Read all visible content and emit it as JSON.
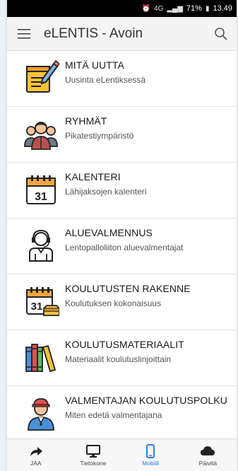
{
  "status_bar": {
    "battery": "71%",
    "time": "13.49",
    "network": "4G"
  },
  "app_bar": {
    "title": "eLENTIS - Avoin"
  },
  "menu_items": [
    {
      "title": "MITÄ UUTTA",
      "subtitle": "Uusinta eLentiksessä",
      "icon": "notepad-pencil-icon"
    },
    {
      "title": "RYHMÄT",
      "subtitle": "Pikatestiympäristö",
      "icon": "people-group-icon"
    },
    {
      "title": "KALENTERI",
      "subtitle": "Lähijaksojen kalenteri",
      "icon": "calendar-icon"
    },
    {
      "title": "ALUEVALMENNUS",
      "subtitle": "Lentopalloliiton aluevalmentajat",
      "icon": "coach-headset-icon"
    },
    {
      "title": "KOULUTUSTEN RAKENNE",
      "subtitle": "Koulutuksen kokonaisuus",
      "icon": "calendar-tray-icon"
    },
    {
      "title": "KOULUTUSMATERIAALIT",
      "subtitle": "Materiaalit koulutuslinjoittain",
      "icon": "books-icon"
    },
    {
      "title": "VALMENTAJAN KOULUTUSPOLKU",
      "subtitle": "Miten edetä valmentajana",
      "icon": "coach-cap-icon"
    }
  ],
  "calendar_day": "31",
  "tabs": [
    {
      "label": "JAA",
      "icon": "share-icon",
      "active": false
    },
    {
      "label": "Tietokone",
      "icon": "desktop-icon",
      "active": false
    },
    {
      "label": "Mobiili",
      "icon": "mobile-icon",
      "active": true
    },
    {
      "label": "Päivitä",
      "icon": "cloud-icon",
      "active": false
    }
  ],
  "colors": {
    "active_tab": "#2b7de9",
    "icon_orange": "#f7a541",
    "icon_yellow": "#fbd84b"
  }
}
